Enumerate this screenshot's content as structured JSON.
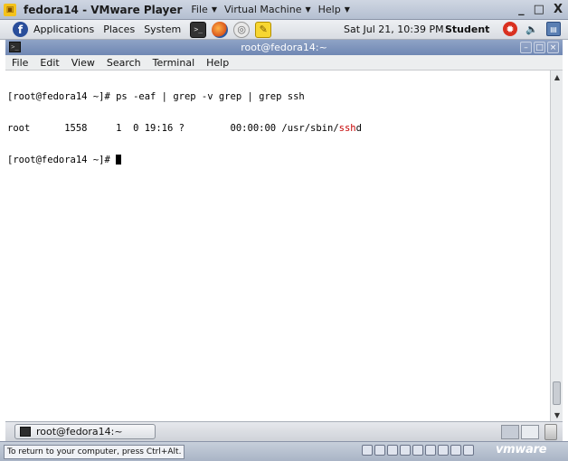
{
  "vmware": {
    "title": "fedora14 - VMware Player",
    "menus": [
      "File",
      "Virtual Machine",
      "Help"
    ],
    "window_controls": [
      "_",
      "□",
      "X"
    ],
    "status_hint": "To return to your computer, press Ctrl+Alt.",
    "brand": "vmware"
  },
  "gnome_panel": {
    "menus": [
      "Applications",
      "Places",
      "System"
    ],
    "clock": "Sat Jul 21, 10:39 PM",
    "user": "Student",
    "icons": [
      "terminal-launcher-icon",
      "firefox-icon",
      "network-icon",
      "notes-icon",
      "update-icon",
      "volume-icon",
      "network-monitor-icon"
    ]
  },
  "terminal": {
    "title": "root@fedora14:~",
    "menus": [
      "File",
      "Edit",
      "View",
      "Search",
      "Terminal",
      "Help"
    ],
    "lines": [
      {
        "text": "[root@fedora14 ~]# ps -eaf | grep -v grep | grep ssh"
      },
      {
        "prefix": "root      1558     1  0 19:16 ?        00:00:00 /usr/sbin/",
        "highlight": "ssh",
        "suffix": "d"
      },
      {
        "text": "[root@fedora14 ~]# "
      }
    ],
    "highlight_color": "#c40000"
  },
  "taskbar": {
    "task_label": "root@fedora14:~"
  }
}
